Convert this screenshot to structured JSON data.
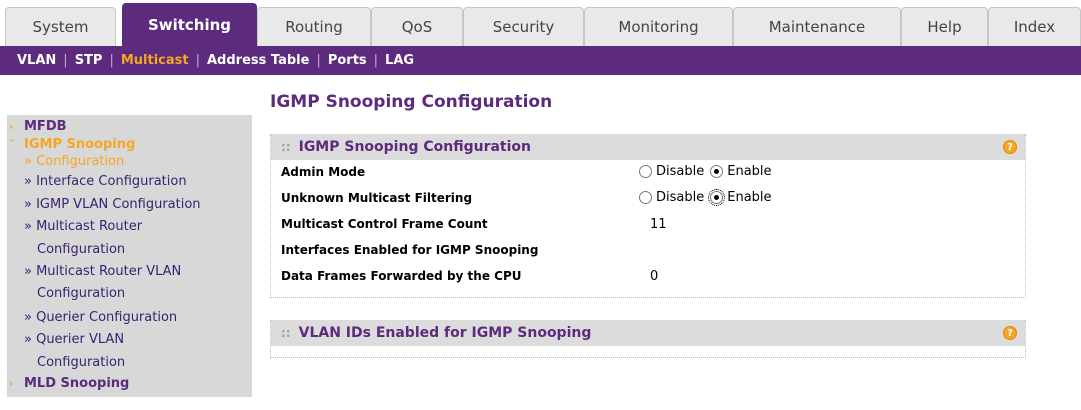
{
  "tabs": [
    {
      "label": "System",
      "active": false
    },
    {
      "label": "Switching",
      "active": true
    },
    {
      "label": "Routing",
      "active": false
    },
    {
      "label": "QoS",
      "active": false
    },
    {
      "label": "Security",
      "active": false
    },
    {
      "label": "Monitoring",
      "active": false
    },
    {
      "label": "Maintenance",
      "active": false
    },
    {
      "label": "Help",
      "active": false
    },
    {
      "label": "Index",
      "active": false
    }
  ],
  "subnav": {
    "items": [
      "VLAN",
      "STP",
      "Multicast",
      "Address Table",
      "Ports",
      "LAG"
    ],
    "current": "Multicast",
    "separator": "|"
  },
  "menu": {
    "mfdb": "MFDB",
    "igmp_snooping": "IGMP Snooping",
    "configuration": "» Configuration",
    "interface_configuration": "» Interface Configuration",
    "igmp_vlan_configuration": "» IGMP VLAN Configuration",
    "multicast_router": "» Multicast Router",
    "multicast_router_cont": "Configuration",
    "multicast_router_vlan": "» Multicast Router VLAN",
    "multicast_router_vlan_cont": "Configuration",
    "querier_configuration": "» Querier Configuration",
    "querier_vlan": "» Querier VLAN",
    "querier_vlan_cont": "Configuration",
    "mld_snooping": "MLD Snooping"
  },
  "page_title": "IGMP Snooping Configuration",
  "config_panel": {
    "title": "IGMP Snooping Configuration",
    "help": "?",
    "rows": {
      "admin_mode": {
        "label": "Admin Mode",
        "disable": "Disable",
        "enable": "Enable",
        "selected": "Enable"
      },
      "unknown_filtering": {
        "label": "Unknown Multicast Filtering",
        "disable": "Disable",
        "enable": "Enable",
        "selected": "Enable"
      },
      "frame_count": {
        "label": "Multicast Control Frame Count",
        "value": "11"
      },
      "interfaces_enabled": {
        "label": "Interfaces Enabled for IGMP Snooping",
        "value": ""
      },
      "data_frames": {
        "label": "Data Frames Forwarded by the CPU",
        "value": "0"
      }
    }
  },
  "vlan_panel": {
    "title": "VLAN IDs Enabled for IGMP Snooping",
    "help": "?"
  },
  "colors": {
    "brand_purple": "#5c2b7e",
    "accent_orange": "#f5a623",
    "panel_header": "#dcdcdc",
    "menu_bg": "#d8d8d8"
  }
}
